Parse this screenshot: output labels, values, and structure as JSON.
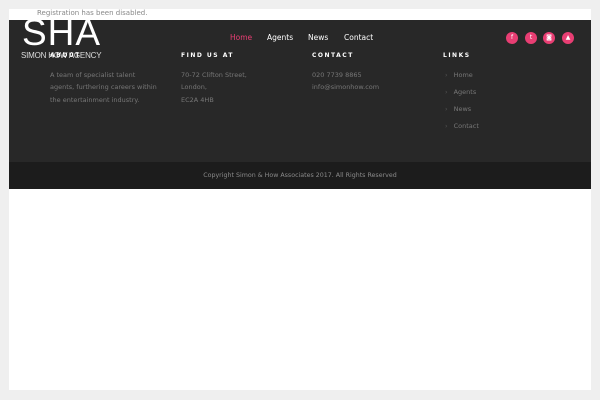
{
  "notice": "Registration has been disabled.",
  "logo": {
    "mark": "SHA",
    "subtitle": "SIMON HOW AGENCY"
  },
  "nav": [
    {
      "label": "Home",
      "active": true
    },
    {
      "label": "Agents"
    },
    {
      "label": "News"
    },
    {
      "label": "Contact"
    }
  ],
  "social": [
    {
      "icon": "facebook-icon",
      "glyph": "f"
    },
    {
      "icon": "twitter-icon",
      "glyph": "t"
    },
    {
      "icon": "instagram-icon",
      "glyph": "◙"
    },
    {
      "icon": "youtube-icon",
      "glyph": "▲"
    }
  ],
  "footer": {
    "about": {
      "heading": "ABOUT",
      "lines": [
        "A team of specialist talent",
        "agents, furthering careers within",
        "the entertainment industry."
      ]
    },
    "find": {
      "heading": "FIND US AT",
      "lines": [
        "70-72 Clifton Street,",
        "London,",
        "EC2A 4HB"
      ]
    },
    "contact": {
      "heading": "CONTACT",
      "phone": "020 7739 8865",
      "email": "info@simonhow.com"
    },
    "links": {
      "heading": "LINKS",
      "items": [
        "Home",
        "Agents",
        "News",
        "Contact"
      ]
    }
  },
  "copyright": "Copyright Simon & How Associates 2017. All Rights Reserved",
  "colors": {
    "accent": "#e83e73",
    "dark": "#282828",
    "bar": "#1c1c1c"
  }
}
